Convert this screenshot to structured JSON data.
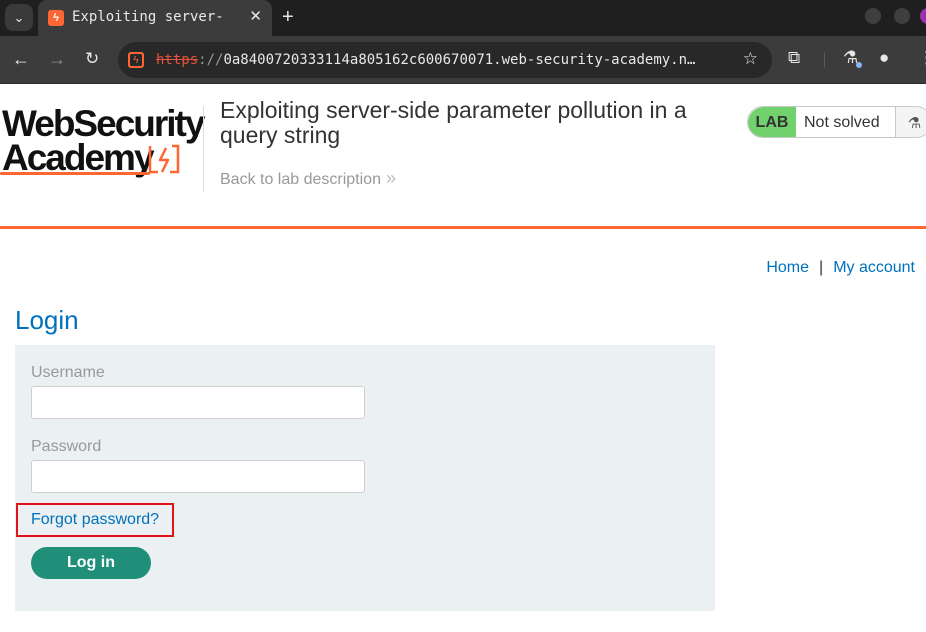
{
  "browser": {
    "tab_title": "Exploiting server-",
    "tab_close": "✕",
    "new_tab": "+",
    "url_scheme": "https",
    "url_sep": "://",
    "url_rest": "0a8400720333114a805162c600670071.web-security-academy.n…"
  },
  "header": {
    "logo_line1": "WebSecurity",
    "logo_line2": "Academy",
    "lab_title": "Exploiting server-side parameter pollution in a query string",
    "back_link": "Back to lab description",
    "back_chevron": "»",
    "lab_badge": "LAB",
    "lab_status": "Not solved"
  },
  "nav": {
    "home": "Home",
    "separator": "|",
    "my_account": "My account"
  },
  "login": {
    "heading": "Login",
    "username_label": "Username",
    "username_value": "",
    "password_label": "Password",
    "password_value": "",
    "forgot_link": "Forgot password?",
    "submit_label": "Log in"
  },
  "colors": {
    "accent_orange": "#ff6633",
    "link_blue": "#0071bc",
    "button_teal": "#1f8f7a",
    "lab_green": "#70d16d",
    "highlight_red": "#e3121a"
  },
  "icons": [
    "tab-list-icon",
    "favicon-icon",
    "close-icon",
    "plus-icon",
    "back-arrow-icon",
    "forward-arrow-icon",
    "reload-icon",
    "site-info-icon",
    "star-icon",
    "extensions-icon",
    "labs-icon",
    "profile-icon",
    "menu-icon",
    "flask-icon"
  ]
}
